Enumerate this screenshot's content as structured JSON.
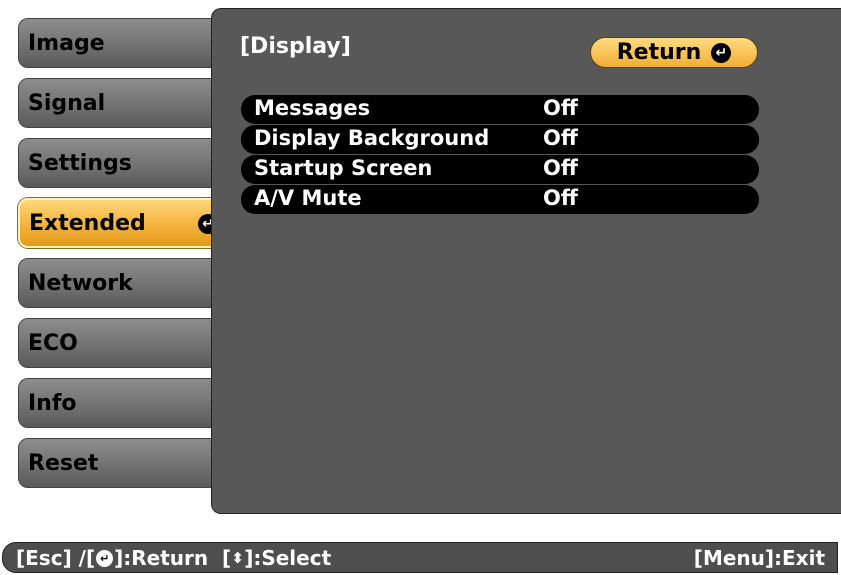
{
  "sidebar": {
    "items": [
      {
        "label": "Image"
      },
      {
        "label": "Signal"
      },
      {
        "label": "Settings"
      },
      {
        "label": "Extended"
      },
      {
        "label": "Network"
      },
      {
        "label": "ECO"
      },
      {
        "label": "Info"
      },
      {
        "label": "Reset"
      }
    ],
    "selected": "Extended"
  },
  "panel": {
    "title": "[Display]",
    "return_label": "Return",
    "rows": [
      {
        "label": "Messages",
        "value": "Off"
      },
      {
        "label": "Display Background",
        "value": "Off"
      },
      {
        "label": "Startup Screen",
        "value": "Off"
      },
      {
        "label": "A/V Mute",
        "value": "Off"
      }
    ]
  },
  "footer": {
    "esc_text": "[Esc] /[",
    "return_text": "]:Return  [",
    "select_text": "]:Select",
    "exit_text": "[Menu]:Exit"
  },
  "colors": {
    "accent": "#f4b23c",
    "panel": "#585858",
    "row": "#000000"
  },
  "icons": {
    "enter": "enter-icon",
    "updown": "up-down-arrow-icon"
  }
}
